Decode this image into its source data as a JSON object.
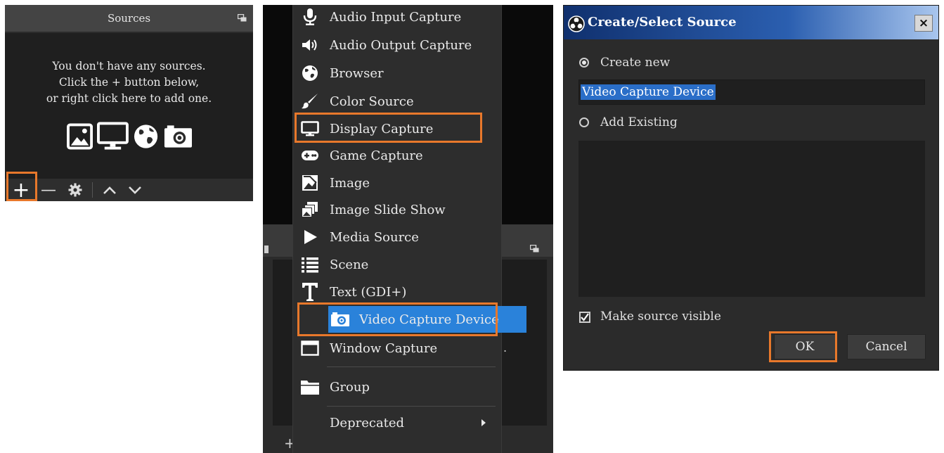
{
  "sources_panel": {
    "title": "Sources",
    "empty_line1": "You don't have any sources.",
    "empty_line2": "Click the + button below,",
    "empty_line3": "or right click here to add one.",
    "toolbar": {
      "add_label": "+",
      "remove_label": "—"
    }
  },
  "add_source_menu": {
    "items": [
      {
        "label": "Audio Input Capture",
        "icon": "microphone-icon"
      },
      {
        "label": "Audio Output Capture",
        "icon": "speaker-icon"
      },
      {
        "label": "Browser",
        "icon": "globe-icon"
      },
      {
        "label": "Color Source",
        "icon": "paintbrush-icon"
      },
      {
        "label": "Display Capture",
        "icon": "monitor-icon"
      },
      {
        "label": "Game Capture",
        "icon": "gamepad-icon"
      },
      {
        "label": "Image",
        "icon": "image-icon"
      },
      {
        "label": "Image Slide Show",
        "icon": "slideshow-icon"
      },
      {
        "label": "Media Source",
        "icon": "play-icon"
      },
      {
        "label": "Scene",
        "icon": "list-icon"
      },
      {
        "label": "Text (GDI+)",
        "icon": "text-icon"
      },
      {
        "label": "Video Capture Device",
        "icon": "camera-icon"
      },
      {
        "label": "Window Capture",
        "icon": "window-icon"
      },
      {
        "label": "Group",
        "icon": "folder-icon"
      },
      {
        "label": "Deprecated",
        "icon": "chevron-right-icon"
      }
    ],
    "selected": "Video Capture Device",
    "highlight_color": "#2a82da"
  },
  "dialog": {
    "title": "Create/Select Source",
    "close_label": "×",
    "create_new_label": "Create new",
    "name_value": "Video Capture Device",
    "add_existing_label": "Add Existing",
    "make_visible_label": "Make source visible",
    "ok_label": "OK",
    "cancel_label": "Cancel"
  },
  "annotation_color": "#e8782b"
}
